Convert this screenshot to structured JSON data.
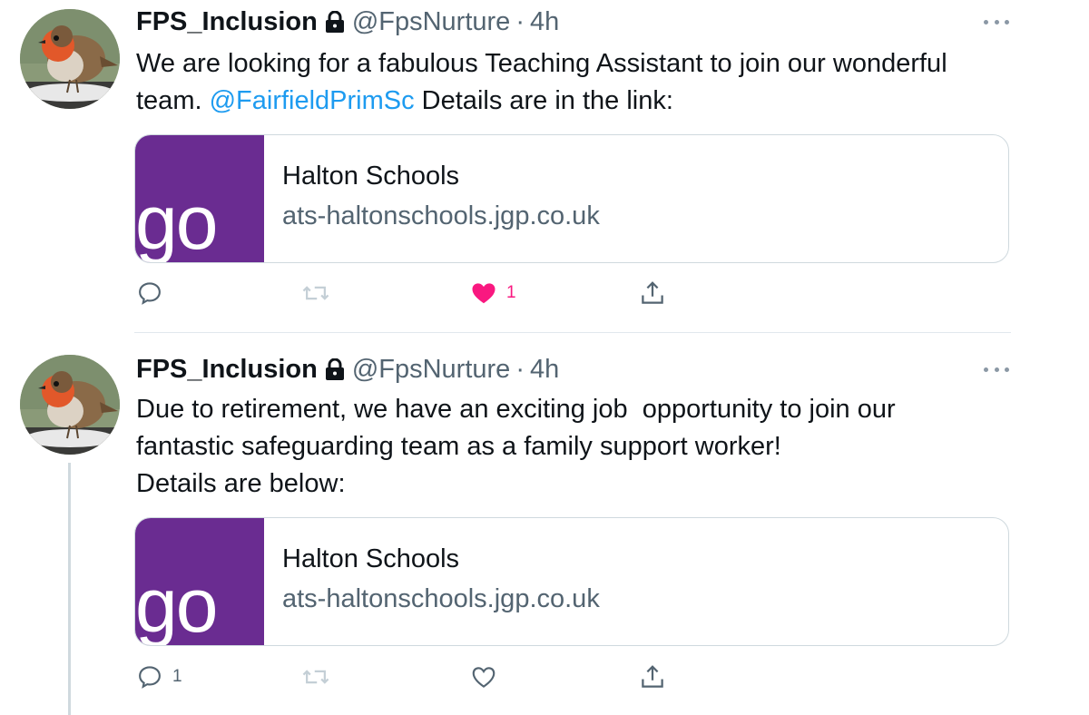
{
  "colors": {
    "accent": "#1d9bf0",
    "like": "#f91880",
    "secondary_text": "#536471",
    "card_brand": "#6a2c91"
  },
  "tweets": [
    {
      "author_name": "FPS_Inclusion",
      "lock_icon": "lock-icon",
      "handle": "@FpsNurture",
      "separator": "·",
      "time": "4h",
      "text_parts": {
        "before": "We are looking for a fabulous Teaching Assistant to join our wonderful team. ",
        "mention": "@FairfieldPrimSc",
        "after": " Details are in the link:"
      },
      "card": {
        "logo_text": "go",
        "title": "Halton Schools",
        "domain": "ats-haltonschools.jgp.co.uk"
      },
      "actions": {
        "reply_count": "",
        "retweet_count": "",
        "like_count": "1",
        "liked": true
      }
    },
    {
      "author_name": "FPS_Inclusion",
      "lock_icon": "lock-icon",
      "handle": "@FpsNurture",
      "separator": "·",
      "time": "4h",
      "text": "Due to retirement, we have an exciting job  opportunity to join our\nfantastic safeguarding team as a family support worker!\nDetails are below:",
      "card": {
        "logo_text": "go",
        "title": "Halton Schools",
        "domain": "ats-haltonschools.jgp.co.uk"
      },
      "actions": {
        "reply_count": "1",
        "retweet_count": "",
        "like_count": "",
        "liked": false
      }
    }
  ]
}
